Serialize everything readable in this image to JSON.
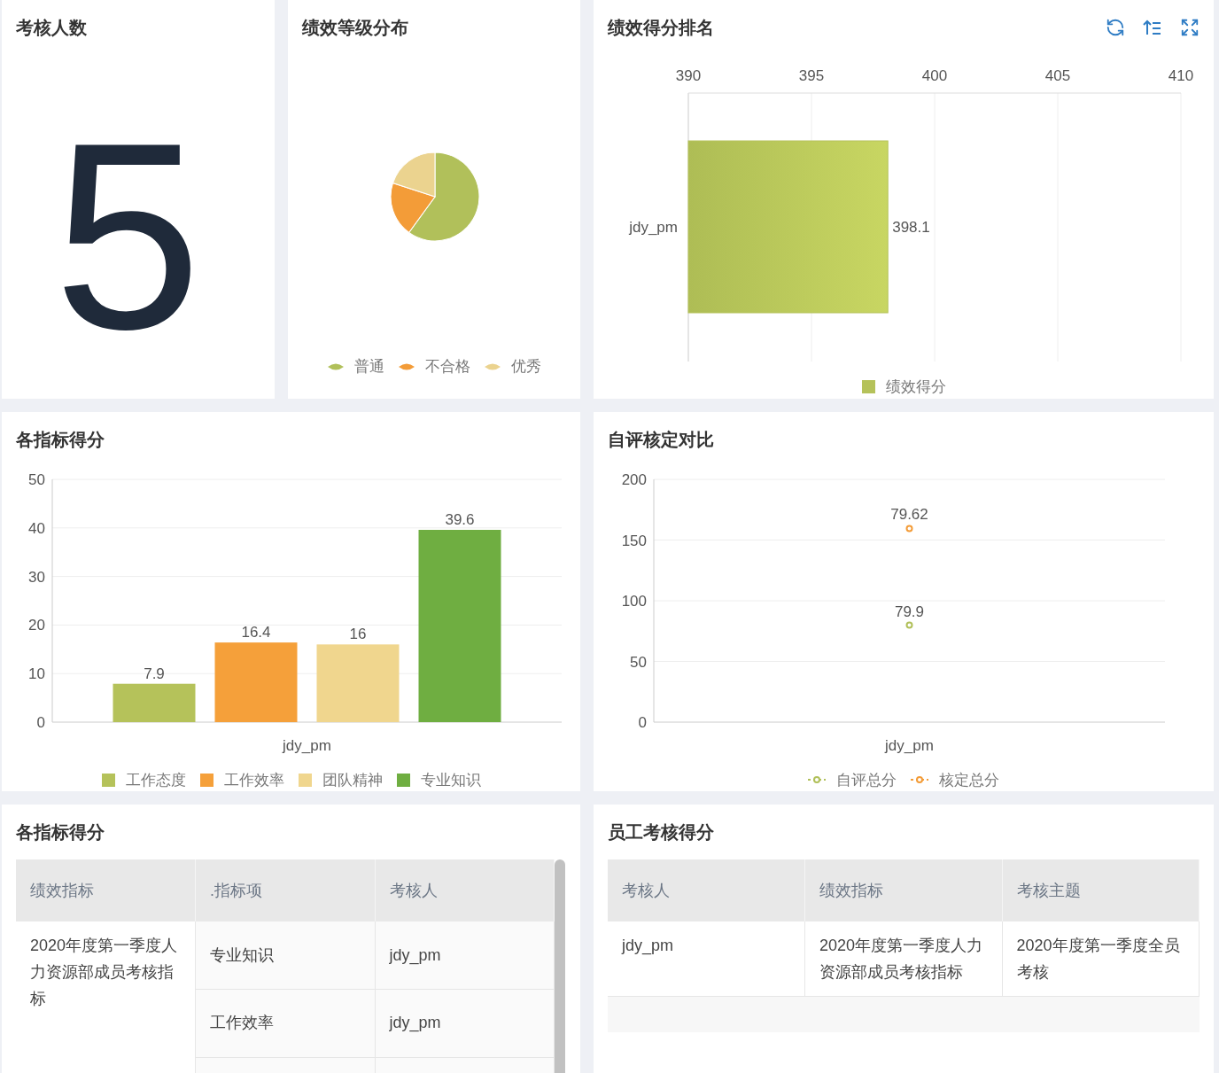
{
  "headcount": {
    "title": "考核人数",
    "value": "5"
  },
  "grade_distribution": {
    "title": "绩效等级分布",
    "legend": [
      {
        "label": "普通",
        "color": "#b1c05a"
      },
      {
        "label": "不合格",
        "color": "#f39c38"
      },
      {
        "label": "优秀",
        "color": "#ebd38f"
      }
    ]
  },
  "score_ranking": {
    "title": "绩效得分排名",
    "chart_data": {
      "type": "bar",
      "orientation": "horizontal",
      "categories": [
        "jdy_pm"
      ],
      "series": [
        {
          "name": "绩效得分",
          "color": "#b5c25a",
          "values": [
            398.1
          ]
        }
      ],
      "xlim": [
        390,
        410
      ],
      "xticks": [
        390,
        395,
        400,
        405,
        410
      ],
      "grid": true,
      "data_labels": true
    }
  },
  "indicator_scores": {
    "title": "各指标得分",
    "chart_data": {
      "type": "bar",
      "categories": [
        "jdy_pm"
      ],
      "series": [
        {
          "name": "工作态度",
          "color": "#b5c25a",
          "values": [
            7.9
          ]
        },
        {
          "name": "工作效率",
          "color": "#f5a03a",
          "values": [
            16.4
          ]
        },
        {
          "name": "团队精神",
          "color": "#f0d68e",
          "values": [
            16
          ]
        },
        {
          "name": "专业知识",
          "color": "#6fae41",
          "values": [
            39.6
          ]
        }
      ],
      "ylim": [
        0,
        50
      ],
      "yticks": [
        0,
        10,
        20,
        30,
        40,
        50
      ],
      "grid": true,
      "data_labels": true
    }
  },
  "self_vs_final": {
    "title": "自评核定对比",
    "chart_data": {
      "type": "line",
      "categories": [
        "jdy_pm"
      ],
      "series": [
        {
          "name": "自评总分",
          "color": "#b1c05a",
          "marker": true,
          "values": [
            79.9
          ]
        },
        {
          "name": "核定总分",
          "color": "#f39c38",
          "marker": true,
          "values": [
            159.5
          ]
        }
      ],
      "ylim": [
        0,
        200
      ],
      "yticks": [
        0,
        50,
        100,
        150,
        200
      ],
      "grid": true,
      "value_labels": [
        [
          "79.9"
        ],
        [
          "79.62"
        ]
      ]
    }
  },
  "indicator_table": {
    "title": "各指标得分",
    "columns": [
      "绩效指标",
      ".指标项",
      "考核人"
    ],
    "groups": [
      {
        "indicator": "2020年度第一季度人力资源部成员考核指标",
        "rows": [
          {
            "item": "专业知识",
            "person": "jdy_pm"
          },
          {
            "item": "工作效率",
            "person": "jdy_pm"
          }
        ]
      }
    ]
  },
  "employee_table": {
    "title": "员工考核得分",
    "columns": [
      "考核人",
      "绩效指标",
      "考核主题"
    ],
    "rows": [
      [
        "jdy_pm",
        "2020年度第一季度人力资源部成员考核指标",
        "2020年度第一季度全员考核"
      ]
    ]
  }
}
